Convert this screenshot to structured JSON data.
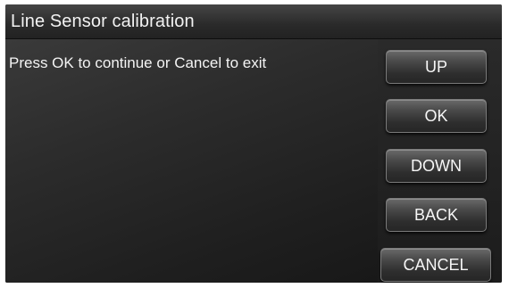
{
  "title_bar": {
    "title": "Line Sensor calibration"
  },
  "content": {
    "message": "Press OK to continue or Cancel to exit"
  },
  "buttons": {
    "up": "UP",
    "ok": "OK",
    "down": "DOWN",
    "back": "BACK",
    "cancel": "CANCEL"
  }
}
